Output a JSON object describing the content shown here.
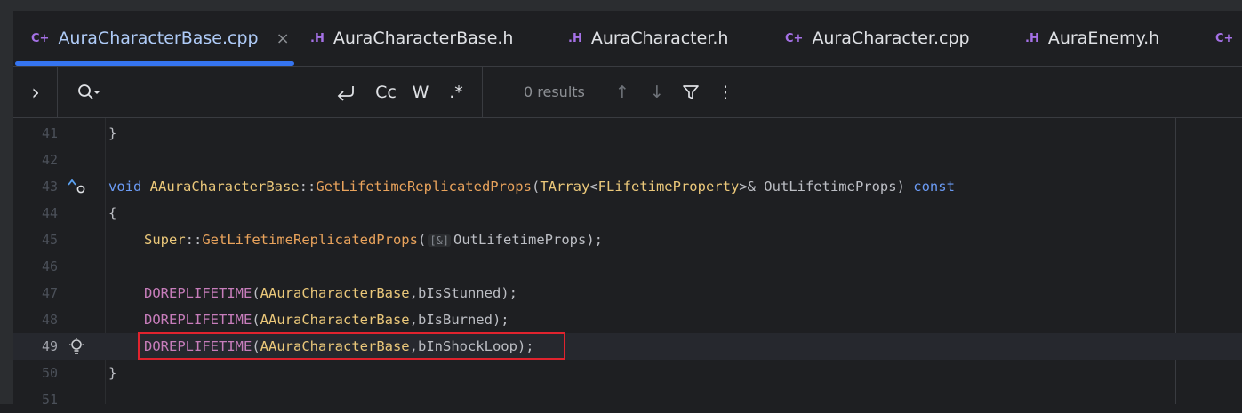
{
  "tabs": [
    {
      "icon": "C+",
      "label": "AuraCharacterBase.cpp",
      "close": "×"
    },
    {
      "icon": ".H",
      "label": "AuraCharacterBase.h"
    },
    {
      "icon": ".H",
      "label": "AuraCharacter.h"
    },
    {
      "icon": "C+",
      "label": "AuraCharacter.cpp"
    },
    {
      "icon": ".H",
      "label": "AuraEnemy.h"
    },
    {
      "icon": "C+",
      "label": ""
    }
  ],
  "search": {
    "expand": "›",
    "search_icon": "magnifier-dropdown",
    "replace_toggle": "⮌",
    "match_case": "Cc",
    "words": "W",
    "regex": ".*",
    "results": "0 results",
    "prev": "↑",
    "next": "↓",
    "filter": "filter-icon",
    "more": "⋮"
  },
  "editor": {
    "lines": [
      {
        "num": "41",
        "text": "}"
      },
      {
        "num": "42",
        "text": ""
      },
      {
        "num": "43",
        "parts": [
          "void",
          " ",
          "AAuraCharacterBase",
          "::",
          "GetLifetimeReplicatedProps",
          "(",
          "TArray",
          "<",
          "FLifetimeProperty",
          ">& OutLifetimeProps) ",
          "const"
        ]
      },
      {
        "num": "44",
        "text": "{"
      },
      {
        "num": "45",
        "parts": [
          "Super",
          "::",
          "GetLifetimeReplicatedProps",
          "(",
          "[&]",
          "OutLifetimeProps);"
        ]
      },
      {
        "num": "46",
        "text": ""
      },
      {
        "num": "47",
        "parts": [
          "DOREPLIFETIME",
          "(",
          "AAuraCharacterBase",
          ",bIsStunned);"
        ]
      },
      {
        "num": "48",
        "parts": [
          "DOREPLIFETIME",
          "(",
          "AAuraCharacterBase",
          ",bIsBurned);"
        ]
      },
      {
        "num": "49",
        "parts": [
          "DOREPLIFETIME",
          "(",
          "AAuraCharacterBase",
          ",bInShockLoop);"
        ]
      },
      {
        "num": "50",
        "text": "}"
      },
      {
        "num": "51",
        "text": ""
      }
    ]
  },
  "colors": {
    "accent": "#3574f0",
    "highlight_border": "#e0232e",
    "keyword": "#6b9bf5",
    "class": "#ebc87a",
    "function": "#e9a35c",
    "macro": "#c77dbb"
  }
}
